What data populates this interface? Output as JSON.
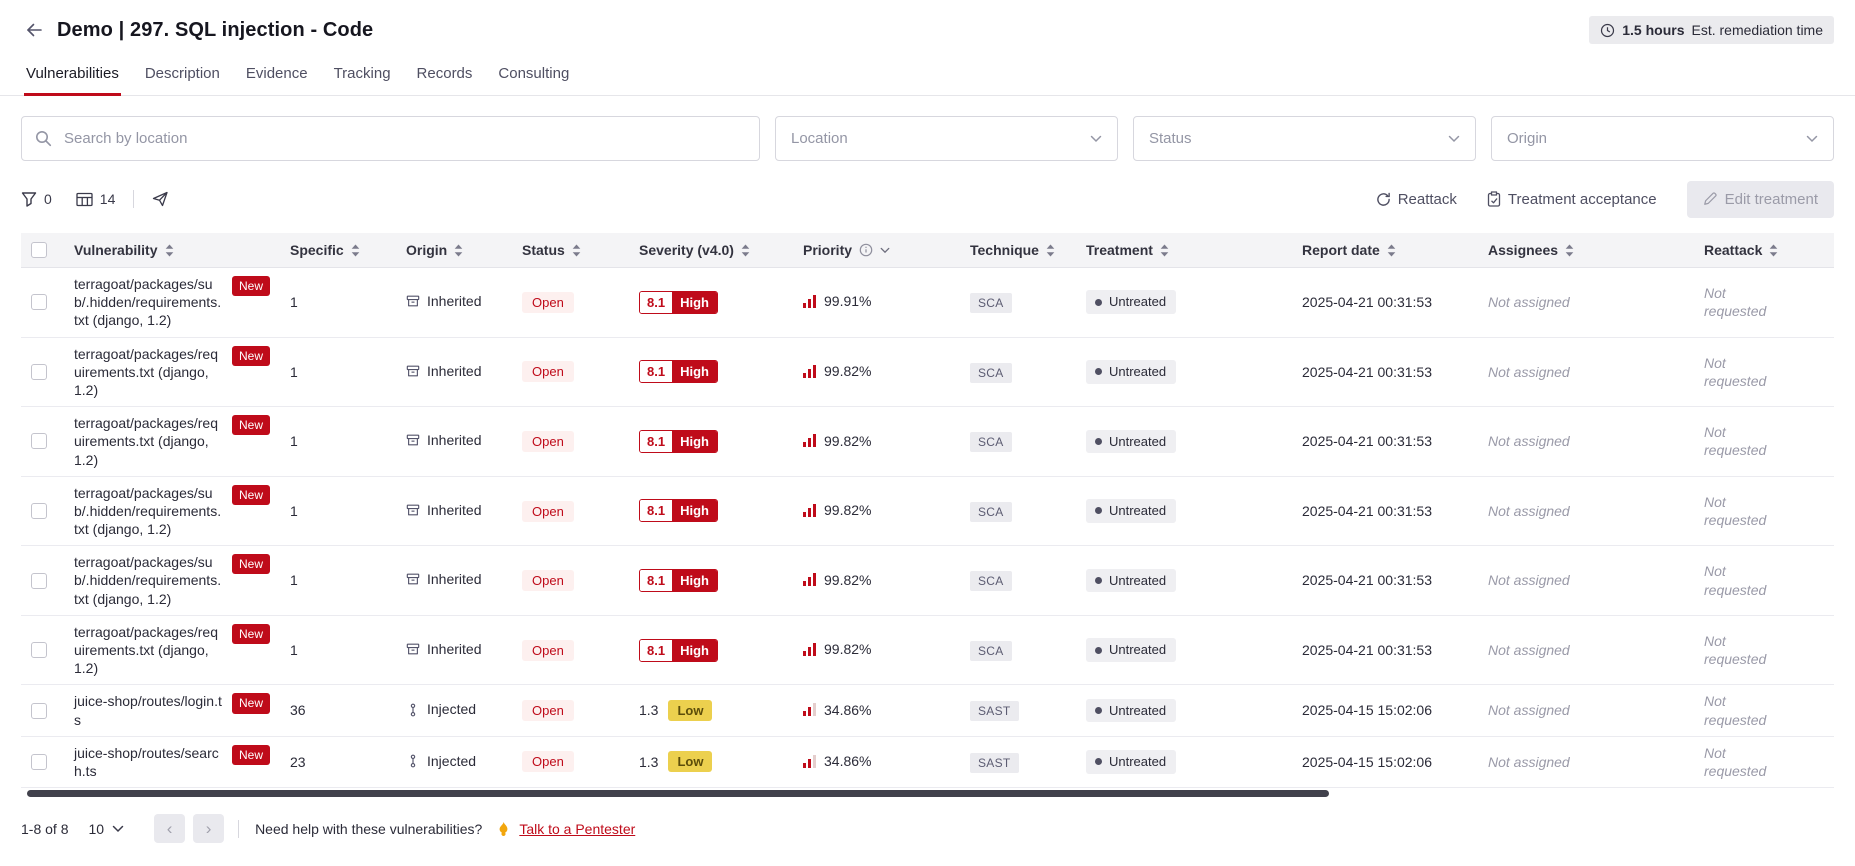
{
  "header": {
    "title": "Demo | 297. SQL injection - Code",
    "remediation_badge": {
      "icon": "clock",
      "duration": "1.5 hours",
      "label": "Est. remediation time"
    }
  },
  "tabs": [
    {
      "label": "Vulnerabilities",
      "active": true
    },
    {
      "label": "Description",
      "active": false
    },
    {
      "label": "Evidence",
      "active": false
    },
    {
      "label": "Tracking",
      "active": false
    },
    {
      "label": "Records",
      "active": false
    },
    {
      "label": "Consulting",
      "active": false
    }
  ],
  "filters": {
    "search": {
      "placeholder": "Search by location",
      "value": "",
      "icon": "magnifier"
    },
    "selects": [
      {
        "placeholder": "Location"
      },
      {
        "placeholder": "Status"
      },
      {
        "placeholder": "Origin"
      }
    ]
  },
  "toolbar": {
    "filter": {
      "icon": "funnel",
      "count": "0"
    },
    "columns": {
      "icon": "table-columns",
      "count": "14"
    },
    "export_icon": "paper-plane",
    "reattack_button": {
      "icon": "refresh",
      "label": "Reattack"
    },
    "treatment_acceptance_button": {
      "icon": "clipboard-check",
      "label": "Treatment acceptance"
    },
    "edit_treatment_button": {
      "icon": "pen",
      "label": "Edit treatment"
    }
  },
  "table": {
    "columns": [
      {
        "key": "vulnerability",
        "label": "Vulnerability",
        "sort": "updown"
      },
      {
        "key": "specific",
        "label": "Specific",
        "sort": "updown"
      },
      {
        "key": "origin",
        "label": "Origin",
        "sort": "updown"
      },
      {
        "key": "status",
        "label": "Status",
        "sort": "updown"
      },
      {
        "key": "severity",
        "label": "Severity (v4.0)",
        "sort": "updown"
      },
      {
        "key": "priority",
        "label": "Priority",
        "info": true,
        "sort": "caret"
      },
      {
        "key": "technique",
        "label": "Technique",
        "sort": "updown"
      },
      {
        "key": "treatment",
        "label": "Treatment",
        "sort": "updown"
      },
      {
        "key": "report_date",
        "label": "Report date",
        "sort": "updown"
      },
      {
        "key": "assignees",
        "label": "Assignees",
        "sort": "updown"
      },
      {
        "key": "reattack",
        "label": "Reattack",
        "sort": "updown"
      }
    ],
    "rows": [
      {
        "location": "terragoat/packages/sub/.hidden/requirements.txt (django, 1.2)",
        "badge": "New",
        "specific": "1",
        "origin": {
          "label": "Inherited",
          "icon": "inherited"
        },
        "status": "Open",
        "severity": {
          "score": "8.1",
          "label": "High",
          "level": "high"
        },
        "priority": {
          "percent": "99.91%",
          "level": "high"
        },
        "technique": "SCA",
        "treatment": "Untreated",
        "report_date": "2025-04-21 00:31:53",
        "assignees": "Not assigned",
        "reattack": "Not requested"
      },
      {
        "location": "terragoat/packages/requirements.txt (django, 1.2)",
        "badge": "New",
        "specific": "1",
        "origin": {
          "label": "Inherited",
          "icon": "inherited"
        },
        "status": "Open",
        "severity": {
          "score": "8.1",
          "label": "High",
          "level": "high"
        },
        "priority": {
          "percent": "99.82%",
          "level": "high"
        },
        "technique": "SCA",
        "treatment": "Untreated",
        "report_date": "2025-04-21 00:31:53",
        "assignees": "Not assigned",
        "reattack": "Not requested"
      },
      {
        "location": "terragoat/packages/requirements.txt (django, 1.2)",
        "badge": "New",
        "specific": "1",
        "origin": {
          "label": "Inherited",
          "icon": "inherited"
        },
        "status": "Open",
        "severity": {
          "score": "8.1",
          "label": "High",
          "level": "high"
        },
        "priority": {
          "percent": "99.82%",
          "level": "high"
        },
        "technique": "SCA",
        "treatment": "Untreated",
        "report_date": "2025-04-21 00:31:53",
        "assignees": "Not assigned",
        "reattack": "Not requested"
      },
      {
        "location": "terragoat/packages/sub/.hidden/requirements.txt (django, 1.2)",
        "badge": "New",
        "specific": "1",
        "origin": {
          "label": "Inherited",
          "icon": "inherited"
        },
        "status": "Open",
        "severity": {
          "score": "8.1",
          "label": "High",
          "level": "high"
        },
        "priority": {
          "percent": "99.82%",
          "level": "high"
        },
        "technique": "SCA",
        "treatment": "Untreated",
        "report_date": "2025-04-21 00:31:53",
        "assignees": "Not assigned",
        "reattack": "Not requested"
      },
      {
        "location": "terragoat/packages/sub/.hidden/requirements.txt (django, 1.2)",
        "badge": "New",
        "specific": "1",
        "origin": {
          "label": "Inherited",
          "icon": "inherited"
        },
        "status": "Open",
        "severity": {
          "score": "8.1",
          "label": "High",
          "level": "high"
        },
        "priority": {
          "percent": "99.82%",
          "level": "high"
        },
        "technique": "SCA",
        "treatment": "Untreated",
        "report_date": "2025-04-21 00:31:53",
        "assignees": "Not assigned",
        "reattack": "Not requested"
      },
      {
        "location": "terragoat/packages/requirements.txt (django, 1.2)",
        "badge": "New",
        "specific": "1",
        "origin": {
          "label": "Inherited",
          "icon": "inherited"
        },
        "status": "Open",
        "severity": {
          "score": "8.1",
          "label": "High",
          "level": "high"
        },
        "priority": {
          "percent": "99.82%",
          "level": "high"
        },
        "technique": "SCA",
        "treatment": "Untreated",
        "report_date": "2025-04-21 00:31:53",
        "assignees": "Not assigned",
        "reattack": "Not requested"
      },
      {
        "location": "juice-shop/routes/login.ts",
        "badge": "New",
        "specific": "36",
        "origin": {
          "label": "Injected",
          "icon": "injected"
        },
        "status": "Open",
        "severity": {
          "score": "1.3",
          "label": "Low",
          "level": "low"
        },
        "priority": {
          "percent": "34.86%",
          "level": "low"
        },
        "technique": "SAST",
        "treatment": "Untreated",
        "report_date": "2025-04-15 15:02:06",
        "assignees": "Not assigned",
        "reattack": "Not requested"
      },
      {
        "location": "juice-shop/routes/search.ts",
        "badge": "New",
        "specific": "23",
        "origin": {
          "label": "Injected",
          "icon": "injected"
        },
        "status": "Open",
        "severity": {
          "score": "1.3",
          "label": "Low",
          "level": "low"
        },
        "priority": {
          "percent": "34.86%",
          "level": "low"
        },
        "technique": "SAST",
        "treatment": "Untreated",
        "report_date": "2025-04-15 15:02:06",
        "assignees": "Not assigned",
        "reattack": "Not requested"
      }
    ]
  },
  "footer": {
    "range": "1-8 of 8",
    "page_size": "10",
    "help_text": "Need help with these vulnerabilities?",
    "help_icon": "flame",
    "link_label": "Talk to a Pentester"
  },
  "colors": {
    "accent_red": "#bf0b1a",
    "severity_low_bg": "#ecd04e",
    "table_header_bg": "#f4f4f6",
    "badge_gray_bg": "#ebebee"
  }
}
